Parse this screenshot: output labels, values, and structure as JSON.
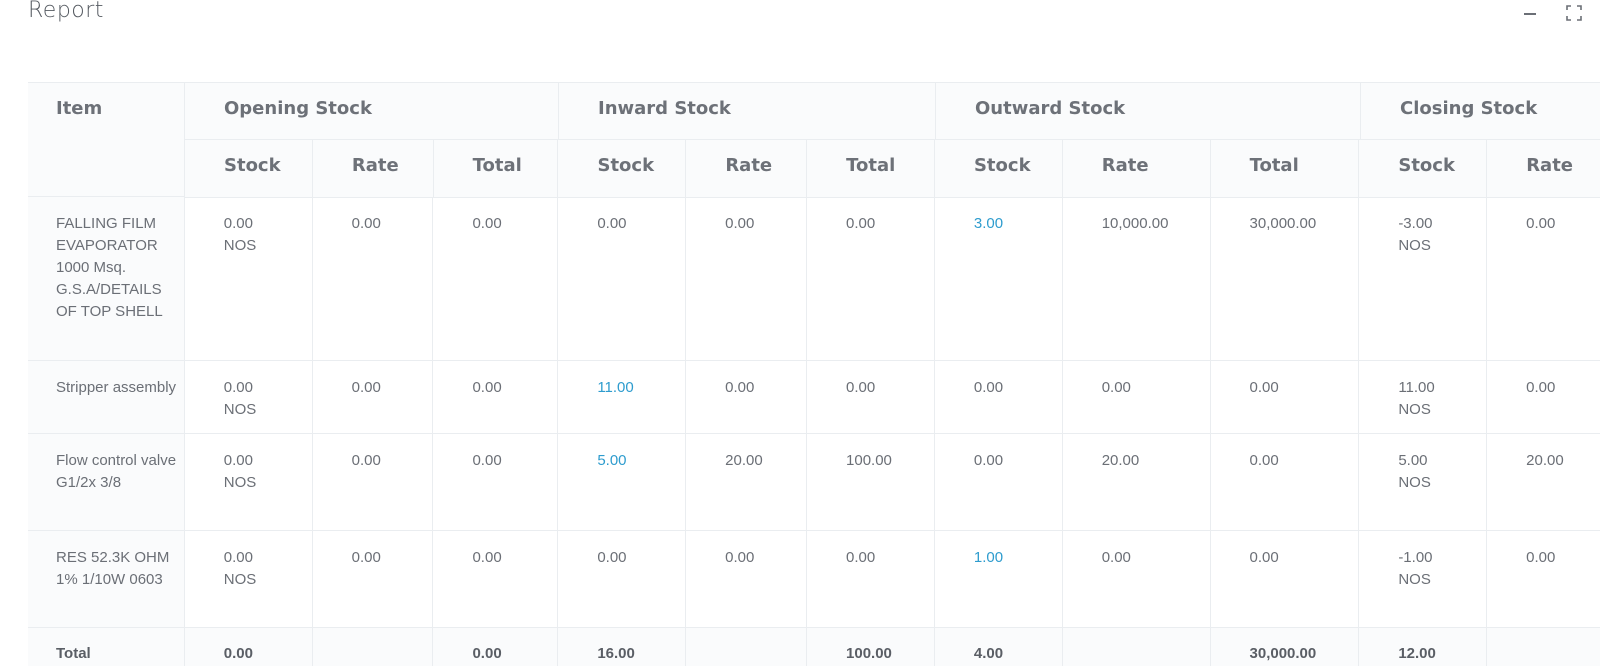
{
  "page": {
    "title": "Report"
  },
  "window": {
    "minimize_icon": "minimize-icon",
    "fullscreen_icon": "fullscreen-icon"
  },
  "table": {
    "item_header": "Item",
    "groups": [
      "Opening Stock",
      "Inward Stock",
      "Outward Stock",
      "Closing Stock"
    ],
    "sub_headers": [
      "Stock",
      "Rate",
      "Total",
      "Stock",
      "Rate",
      "Total",
      "Stock",
      "Rate",
      "Total",
      "Stock",
      "Rate"
    ],
    "rows": [
      {
        "item": "FALLING FILM EVAPORATOR 1000 Msq. G.S.A/DETAILS OF TOP SHELL",
        "op_stock": "0.00",
        "op_unit": "NOS",
        "op_rate": "0.00",
        "op_total": "0.00",
        "in_stock": "0.00",
        "in_rate": "0.00",
        "in_total": "0.00",
        "out_stock": "3.00",
        "out_rate": "10,000.00",
        "out_total": "30,000.00",
        "cl_stock": "-3.00",
        "cl_unit": "NOS",
        "cl_rate": "0.00"
      },
      {
        "item": "Stripper assembly",
        "op_stock": "0.00",
        "op_unit": "NOS",
        "op_rate": "0.00",
        "op_total": "0.00",
        "in_stock": "11.00",
        "in_rate": "0.00",
        "in_total": "0.00",
        "out_stock": "0.00",
        "out_rate": "0.00",
        "out_total": "0.00",
        "cl_stock": "11.00",
        "cl_unit": "NOS",
        "cl_rate": "0.00"
      },
      {
        "item": "Flow control valve G1/2x 3/8",
        "op_stock": "0.00",
        "op_unit": "NOS",
        "op_rate": "0.00",
        "op_total": "0.00",
        "in_stock": "5.00",
        "in_rate": "20.00",
        "in_total": "100.00",
        "out_stock": "0.00",
        "out_rate": "20.00",
        "out_total": "0.00",
        "cl_stock": "5.00",
        "cl_unit": "NOS",
        "cl_rate": "20.00"
      },
      {
        "item": "RES 52.3K OHM 1% 1/10W 0603",
        "op_stock": "0.00",
        "op_unit": "NOS",
        "op_rate": "0.00",
        "op_total": "0.00",
        "in_stock": "0.00",
        "in_rate": "0.00",
        "in_total": "0.00",
        "out_stock": "1.00",
        "out_rate": "0.00",
        "out_total": "0.00",
        "cl_stock": "-1.00",
        "cl_unit": "NOS",
        "cl_rate": "0.00"
      }
    ],
    "totals": {
      "label": "Total",
      "op_stock": "0.00",
      "op_total": "0.00",
      "in_stock": "16.00",
      "in_total": "100.00",
      "out_stock": "4.00",
      "out_total": "30,000.00",
      "cl_stock": "12.00"
    }
  }
}
